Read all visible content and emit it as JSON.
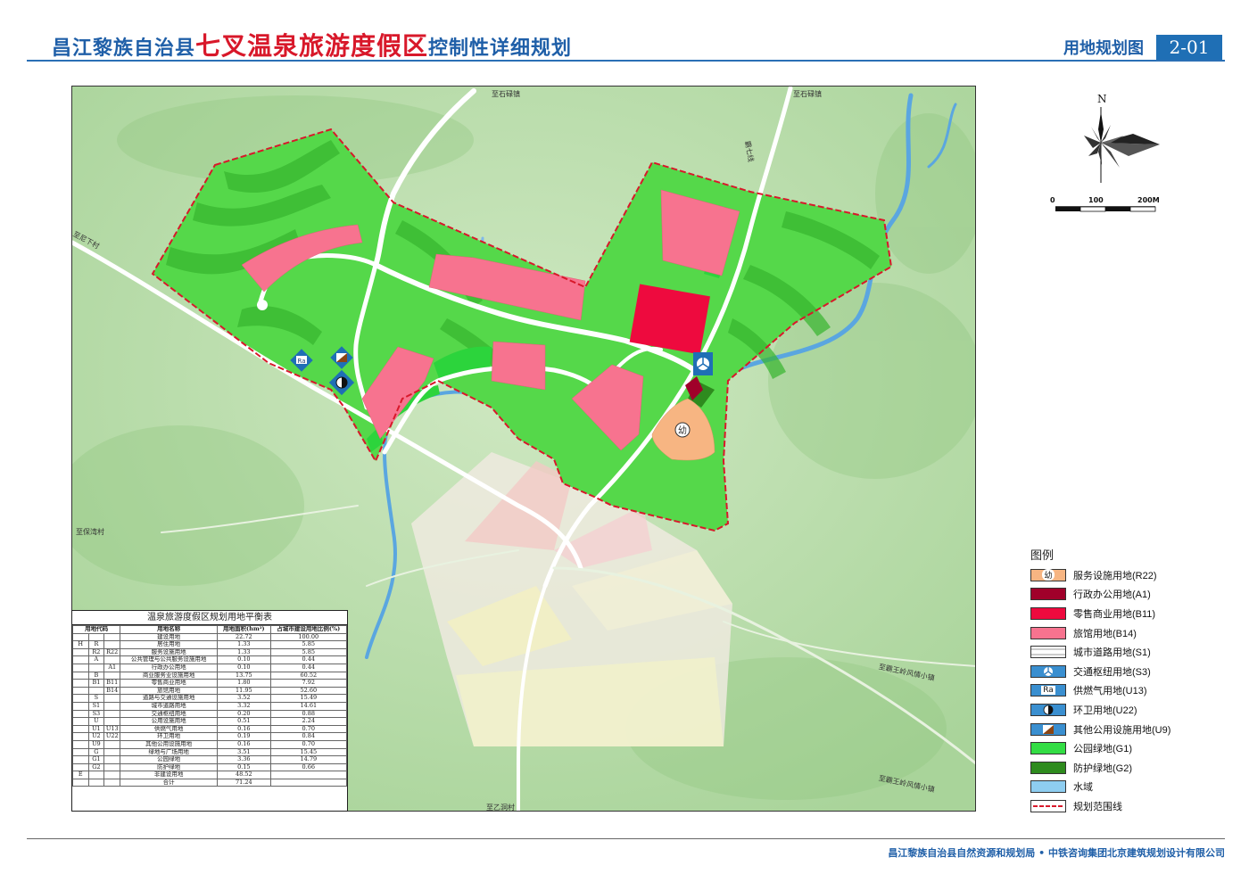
{
  "header": {
    "title_prefix": "昌江黎族自治县",
    "title_emphasis": "七叉温泉旅游度假区",
    "title_suffix": "控制性详细规划",
    "sheet_title": "用地规划图",
    "sheet_number": "2-01"
  },
  "road_labels": {
    "north_1": "至石碌镇",
    "north_2": "至石碌镇",
    "ba_qi_line": "霸七线",
    "west": "至尼下村",
    "southwest": "至保湾村",
    "south": "至乙洞村",
    "east_1": "至霸王岭风情小镇",
    "east_2": "至霸王岭风情小镇"
  },
  "map_symbols": {
    "kindergarten": "幼",
    "gas_supply": "Ra"
  },
  "compass": {
    "north_label": "N",
    "scale_ticks": [
      "0",
      "100",
      "200M"
    ]
  },
  "balance_table": {
    "title": "温泉旅游度假区规划用地平衡表",
    "headers": [
      "用地代码",
      "用地名称",
      "用地面积(hm²)",
      "占城市建设用地比例(%)"
    ],
    "rows": [
      {
        "c1": "",
        "c2": "",
        "c3": "",
        "name": "建设用地",
        "area": "22.72",
        "ratio": "100.00"
      },
      {
        "c1": "H",
        "c2": "R",
        "c3": "",
        "name": "居住用地",
        "area": "1.33",
        "ratio": "5.85"
      },
      {
        "c1": "",
        "c2": "R2",
        "c3": "R22",
        "name": "服务设施用地",
        "area": "1.33",
        "ratio": "5.85"
      },
      {
        "c1": "",
        "c2": "A",
        "c3": "",
        "name": "公共管理与公共服务设施用地",
        "area": "0.10",
        "ratio": "0.44"
      },
      {
        "c1": "",
        "c2": "",
        "c3": "A1",
        "name": "行政办公用地",
        "area": "0.10",
        "ratio": "0.44"
      },
      {
        "c1": "",
        "c2": "B",
        "c3": "",
        "name": "商业服务业设施用地",
        "area": "13.75",
        "ratio": "60.52"
      },
      {
        "c1": "",
        "c2": "B1",
        "c3": "B11",
        "name": "零售商业用地",
        "area": "1.80",
        "ratio": "7.92"
      },
      {
        "c1": "",
        "c2": "",
        "c3": "B14",
        "name": "旅馆用地",
        "area": "11.95",
        "ratio": "52.60"
      },
      {
        "c1": "",
        "c2": "S",
        "c3": "",
        "name": "道路与交通设施用地",
        "area": "3.52",
        "ratio": "15.49"
      },
      {
        "c1": "",
        "c2": "S1",
        "c3": "",
        "name": "城市道路用地",
        "area": "3.32",
        "ratio": "14.61"
      },
      {
        "c1": "",
        "c2": "S3",
        "c3": "",
        "name": "交通枢纽用地",
        "area": "0.20",
        "ratio": "0.88"
      },
      {
        "c1": "",
        "c2": "U",
        "c3": "",
        "name": "公用设施用地",
        "area": "0.51",
        "ratio": "2.24"
      },
      {
        "c1": "",
        "c2": "U1",
        "c3": "U13",
        "name": "供燃气用地",
        "area": "0.16",
        "ratio": "0.70"
      },
      {
        "c1": "",
        "c2": "U2",
        "c3": "U22",
        "name": "环卫用地",
        "area": "0.19",
        "ratio": "0.84"
      },
      {
        "c1": "",
        "c2": "U9",
        "c3": "",
        "name": "其他公用设施用地",
        "area": "0.16",
        "ratio": "0.70"
      },
      {
        "c1": "",
        "c2": "G",
        "c3": "",
        "name": "绿地与广场用地",
        "area": "3.51",
        "ratio": "15.45"
      },
      {
        "c1": "",
        "c2": "G1",
        "c3": "",
        "name": "公园绿地",
        "area": "3.36",
        "ratio": "14.79"
      },
      {
        "c1": "",
        "c2": "G2",
        "c3": "",
        "name": "防护绿地",
        "area": "0.15",
        "ratio": "0.66"
      },
      {
        "c1": "E",
        "c2": "",
        "c3": "",
        "name": "非建设用地",
        "area": "48.52",
        "ratio": ""
      },
      {
        "c1": "",
        "c2": "",
        "c3": "",
        "name": "合计",
        "area": "71.24",
        "ratio": ""
      }
    ]
  },
  "legend": {
    "title": "图例",
    "items": [
      {
        "label": "服务设施用地(R22)",
        "color": "#f7b582",
        "symbol": "幼",
        "icon": "kindergarten-icon"
      },
      {
        "label": "行政办公用地(A1)",
        "color": "#a0002a",
        "symbol": "",
        "icon": ""
      },
      {
        "label": "零售商业用地(B11)",
        "color": "#ee0a3e",
        "symbol": "",
        "icon": ""
      },
      {
        "label": "旅馆用地(B14)",
        "color": "#f7738f",
        "symbol": "",
        "icon": ""
      },
      {
        "label": "城市道路用地(S1)",
        "color": "#ffffff",
        "symbol": "",
        "icon": "road-icon"
      },
      {
        "label": "交通枢纽用地(S3)",
        "color": "#3a8fd0",
        "symbol": "",
        "icon": "transit-hub-icon"
      },
      {
        "label": "供燃气用地(U13)",
        "color": "#3a8fd0",
        "symbol": "Ra",
        "icon": "gas-supply-icon"
      },
      {
        "label": "环卫用地(U22)",
        "color": "#3a8fd0",
        "symbol": "",
        "icon": "sanitation-icon"
      },
      {
        "label": "其他公用设施用地(U9)",
        "color": "#3a8fd0",
        "symbol": "",
        "icon": "other-utility-icon"
      },
      {
        "label": "公园绿地(G1)",
        "color": "#33dd44",
        "symbol": "",
        "icon": ""
      },
      {
        "label": "防护绿地(G2)",
        "color": "#2e8b1e",
        "symbol": "",
        "icon": ""
      },
      {
        "label": "水域",
        "color": "#8ecdf0",
        "symbol": "",
        "icon": ""
      },
      {
        "label": "规划范围线",
        "color": "#d8182a",
        "symbol": "",
        "icon": "boundary-line-icon"
      }
    ]
  },
  "footer": {
    "credits": "昌江黎族自治县自然资源和规划局 • 中铁咨询集团北京建筑规划设计有限公司"
  }
}
